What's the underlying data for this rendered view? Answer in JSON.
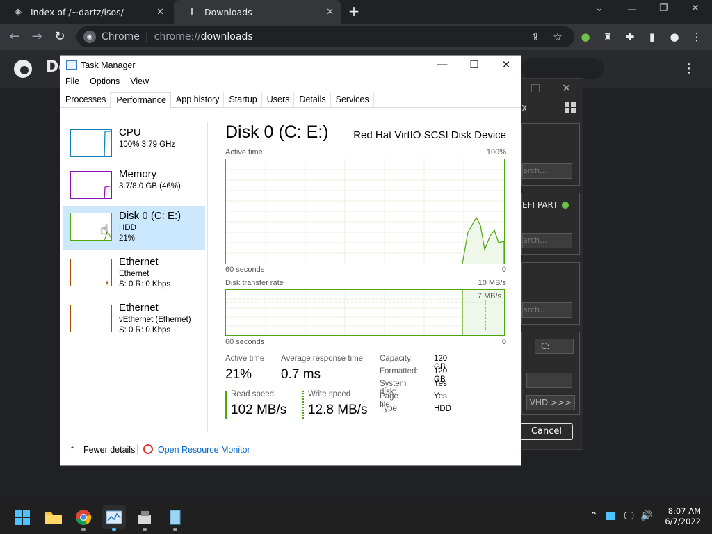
{
  "browser": {
    "tabs": [
      {
        "title": "Index of /~dartz/isos/",
        "icon": "page-icon"
      },
      {
        "title": "Downloads",
        "icon": "download-icon"
      }
    ],
    "omnibox": {
      "scheme_label": "Chrome",
      "url_prefix": "chrome://",
      "url_path": "downloads"
    },
    "page_title": "Do"
  },
  "background_dialog": {
    "x_label": "X",
    "search_placeholder": "arch...",
    "efi_label": "EFI PART",
    "drive_letter": "C:",
    "vhd_label": "VHD >>>",
    "cancel_label": "Cancel"
  },
  "task_manager": {
    "title": "Task Manager",
    "menu": [
      "File",
      "Options",
      "View"
    ],
    "tabs": [
      "Processes",
      "Performance",
      "App history",
      "Startup",
      "Users",
      "Details",
      "Services"
    ],
    "active_tab": "Performance",
    "sidebar": [
      {
        "name": "CPU",
        "line1": "100%  3.79 GHz",
        "line2": "",
        "color": "#117dbb"
      },
      {
        "name": "Memory",
        "line1": "3.7/8.0 GB (46%)",
        "line2": "",
        "color": "#8b12ae"
      },
      {
        "name": "Disk 0 (C: E:)",
        "line1": "HDD",
        "line2": "21%",
        "color": "#4da60c"
      },
      {
        "name": "Ethernet",
        "line1": "Ethernet",
        "line2": "S: 0  R: 0 Kbps",
        "color": "#a74f01"
      },
      {
        "name": "Ethernet",
        "line1": "vEthernet (Ethernet)",
        "line2": "S: 0  R: 0 Kbps",
        "color": "#a74f01"
      }
    ],
    "detail": {
      "title": "Disk 0 (C: E:)",
      "device": "Red Hat VirtIO SCSI Disk Device",
      "graph1": {
        "label": "Active time",
        "max": "100%",
        "xleft": "60 seconds",
        "xright": "0"
      },
      "graph2": {
        "label": "Disk transfer rate",
        "max": "10 MB/s",
        "inner": "7 MB/s",
        "xleft": "60 seconds",
        "xright": "0"
      },
      "active_time_label": "Active time",
      "active_time_value": "21%",
      "avg_resp_label": "Average response time",
      "avg_resp_value": "0.7 ms",
      "read_label": "Read speed",
      "read_value": "102 MB/s",
      "write_label": "Write speed",
      "write_value": "12.8 MB/s",
      "props": [
        {
          "k": "Capacity:",
          "v": "120 GB"
        },
        {
          "k": "Formatted:",
          "v": "120 GB"
        },
        {
          "k": "System disk:",
          "v": "Yes"
        },
        {
          "k": "Page file:",
          "v": "Yes"
        },
        {
          "k": "Type:",
          "v": "HDD"
        }
      ]
    },
    "footer": {
      "fewer_details": "Fewer details",
      "resource_monitor": "Open Resource Monitor"
    }
  },
  "taskbar": {
    "clock_time": "8:07 AM",
    "clock_date": "6/7/2022"
  }
}
